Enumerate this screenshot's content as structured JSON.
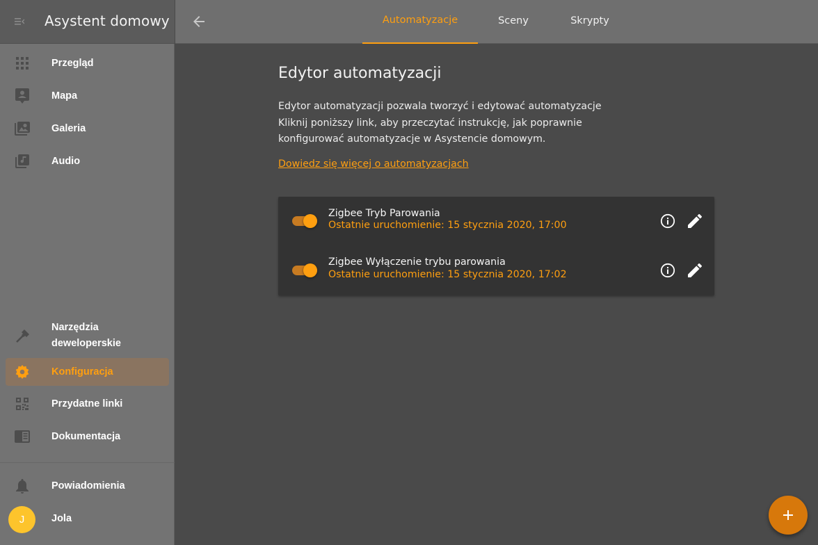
{
  "app": {
    "title": "Asystent domowy"
  },
  "sidebar": {
    "items": [
      {
        "label": "Przegląd",
        "icon": "apps-grid-icon"
      },
      {
        "label": "Mapa",
        "icon": "account-box-icon"
      },
      {
        "label": "Galeria",
        "icon": "image-account-icon"
      },
      {
        "label": "Audio",
        "icon": "music-library-icon"
      },
      {
        "label": "Narzędzia deweloperskie",
        "icon": "hammer-icon"
      },
      {
        "label": "Konfiguracja",
        "icon": "cog-icon",
        "active": true
      },
      {
        "label": "Przydatne linki",
        "icon": "qrcode-icon"
      },
      {
        "label": "Dokumentacja",
        "icon": "book-icon"
      }
    ],
    "notifications": {
      "label": "Powiadomienia",
      "icon": "bell-icon"
    },
    "user": {
      "label": "Jola",
      "initial": "J"
    }
  },
  "tabs": [
    {
      "label": "Automatyzacje",
      "active": true
    },
    {
      "label": "Sceny"
    },
    {
      "label": "Skrypty"
    }
  ],
  "content": {
    "title": "Edytor automatyzacji",
    "description_lines": [
      "Edytor automatyzacji pozwala tworzyć i edytować automatyzacje",
      "Kliknij poniższy link, aby przeczytać instrukcję, jak poprawnie",
      "konfigurować automatyzacje w Asystencie domowym."
    ],
    "learn_more": "Dowiedz się więcej o automatyzacjach"
  },
  "automations": [
    {
      "name": "Zigbee Tryb Parowania",
      "last_run": "Ostatnie uruchomienie: 15 stycznia 2020, 17:00",
      "enabled": true
    },
    {
      "name": "Zigbee Wyłączenie trybu parowania",
      "last_run": "Ostatnie uruchomienie: 15 stycznia 2020, 17:02",
      "enabled": true
    }
  ],
  "colors": {
    "accent": "#ff9f10",
    "sidebar_bg": "#737373",
    "content_bg": "#4a4a4a",
    "card_bg": "#333333",
    "fab": "#d7780b",
    "avatar": "#fdc42c"
  },
  "fab": {
    "icon": "plus-icon"
  }
}
